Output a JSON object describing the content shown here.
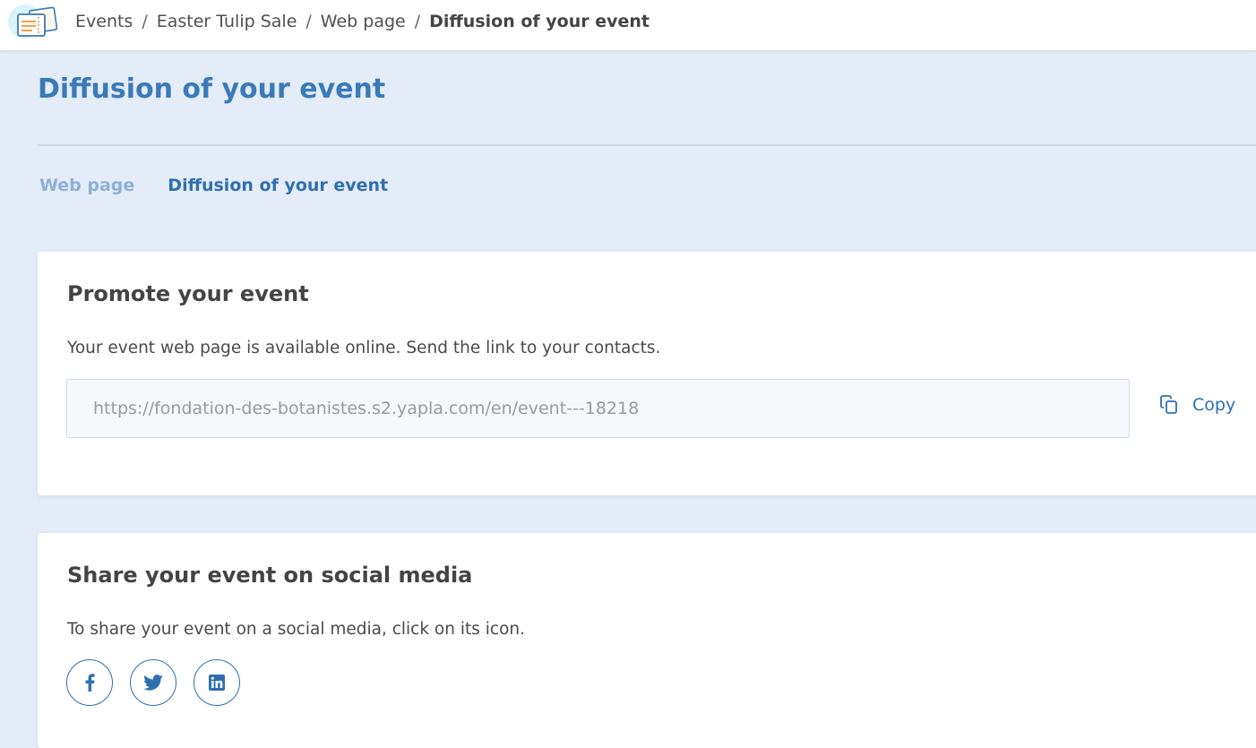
{
  "breadcrumb": {
    "items": [
      "Events",
      "Easter Tulip Sale",
      "Web page"
    ],
    "current": "Diffusion of your event",
    "separator": "/"
  },
  "page": {
    "title": "Diffusion of your event"
  },
  "tabs": [
    {
      "label": "Web page",
      "active": false
    },
    {
      "label": "Diffusion of your event",
      "active": true
    }
  ],
  "promote": {
    "title": "Promote your event",
    "description": "Your event web page is available online. Send the link to your contacts.",
    "url": "https://fondation-des-botanistes.s2.yapla.com/en/event---18218",
    "copy_label": "Copy"
  },
  "share": {
    "title": "Share your event on social media",
    "description": "To share your event on a social media, click on its icon.",
    "networks": [
      "facebook-icon",
      "twitter-icon",
      "linkedin-icon"
    ]
  },
  "colors": {
    "accent": "#2f6fb0",
    "title": "#3a7ab8",
    "background": "#e4ecf8",
    "inactive_tab": "#8cb1d8"
  }
}
